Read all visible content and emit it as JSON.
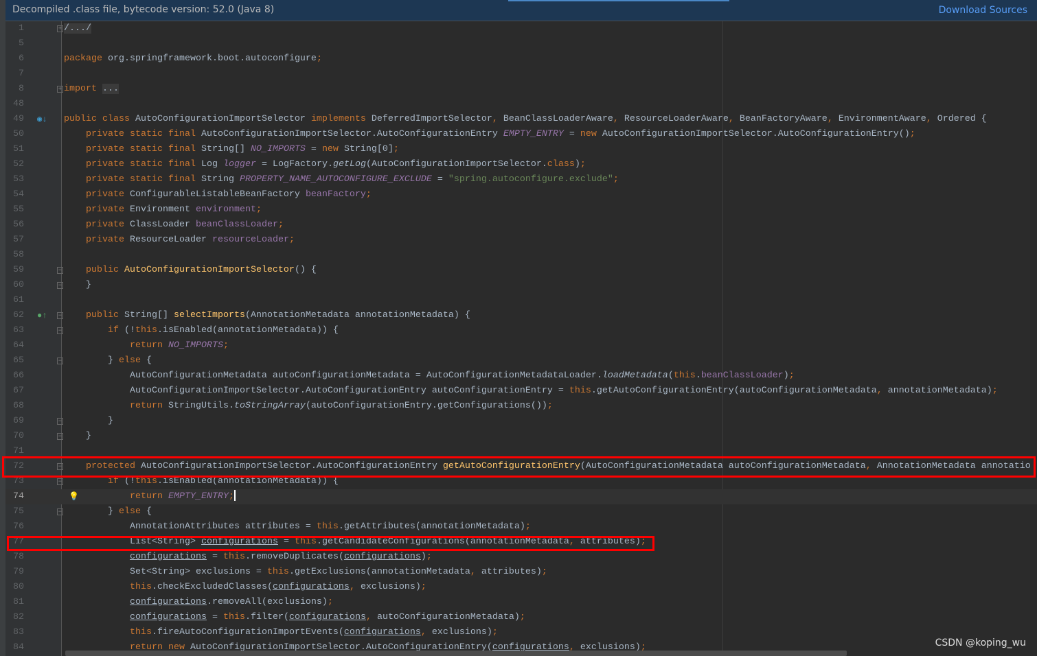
{
  "banner": {
    "message": "Decompiled .class file, bytecode version: 52.0 (Java 8)",
    "download_label": "Download Sources"
  },
  "watermark": "CSDN @koping_wu",
  "colors": {
    "keyword": "#cc7832",
    "text": "#a9b7c6",
    "field": "#9876aa",
    "string": "#6a8759",
    "method": "#ffc66d",
    "highlight_box": "#ff0000"
  },
  "current_line": "74",
  "code": {
    "lines": [
      {
        "n": "1",
        "fold": "plus",
        "tokens": [
          [
            "fd",
            "/.../"
          ]
        ]
      },
      {
        "n": "5",
        "tokens": []
      },
      {
        "n": "6",
        "tokens": [
          [
            "k",
            "package "
          ],
          [
            "t",
            "org.springframework.boot.autoconfigure"
          ],
          [
            "k",
            ";"
          ]
        ]
      },
      {
        "n": "7",
        "tokens": []
      },
      {
        "n": "8",
        "fold": "plus",
        "tokens": [
          [
            "k",
            "import "
          ],
          [
            "fd",
            "..."
          ]
        ]
      },
      {
        "n": "48",
        "tokens": []
      },
      {
        "n": "49",
        "icon": "implemented-icon",
        "tokens": [
          [
            "k",
            "public class "
          ],
          [
            "t",
            "AutoConfigurationImportSelector "
          ],
          [
            "k",
            "implements "
          ],
          [
            "t",
            "DeferredImportSelector"
          ],
          [
            "k",
            ", "
          ],
          [
            "t",
            "BeanClassLoaderAware"
          ],
          [
            "k",
            ", "
          ],
          [
            "t",
            "ResourceLoaderAware"
          ],
          [
            "k",
            ", "
          ],
          [
            "t",
            "BeanFactoryAware"
          ],
          [
            "k",
            ", "
          ],
          [
            "t",
            "EnvironmentAware"
          ],
          [
            "k",
            ", "
          ],
          [
            "t",
            "Ordered {"
          ]
        ]
      },
      {
        "n": "50",
        "tokens": [
          [
            "k",
            "    private static final "
          ],
          [
            "t",
            "AutoConfigurationImportSelector.AutoConfigurationEntry "
          ],
          [
            "sf",
            "EMPTY_ENTRY"
          ],
          [
            "t",
            " = "
          ],
          [
            "k",
            "new "
          ],
          [
            "t",
            "AutoConfigurationImportSelector.AutoConfigurationEntry()"
          ],
          [
            "k",
            ";"
          ]
        ]
      },
      {
        "n": "51",
        "tokens": [
          [
            "k",
            "    private static final "
          ],
          [
            "t",
            "String[] "
          ],
          [
            "sf",
            "NO_IMPORTS"
          ],
          [
            "t",
            " = "
          ],
          [
            "k",
            "new "
          ],
          [
            "t",
            "String[0]"
          ],
          [
            "k",
            ";"
          ]
        ]
      },
      {
        "n": "52",
        "tokens": [
          [
            "k",
            "    private static final "
          ],
          [
            "t",
            "Log "
          ],
          [
            "sf",
            "logger"
          ],
          [
            "t",
            " = LogFactory."
          ],
          [
            "i",
            "getLog"
          ],
          [
            "t",
            "(AutoConfigurationImportSelector."
          ],
          [
            "k",
            "class"
          ],
          [
            "t",
            ")"
          ],
          [
            "k",
            ";"
          ]
        ]
      },
      {
        "n": "53",
        "tokens": [
          [
            "k",
            "    private static final "
          ],
          [
            "t",
            "String "
          ],
          [
            "sf",
            "PROPERTY_NAME_AUTOCONFIGURE_EXCLUDE"
          ],
          [
            "t",
            " = "
          ],
          [
            "s",
            "\"spring.autoconfigure.exclude\""
          ],
          [
            "k",
            ";"
          ]
        ]
      },
      {
        "n": "54",
        "tokens": [
          [
            "k",
            "    private "
          ],
          [
            "t",
            "ConfigurableListableBeanFactory "
          ],
          [
            "f",
            "beanFactory"
          ],
          [
            "k",
            ";"
          ]
        ]
      },
      {
        "n": "55",
        "tokens": [
          [
            "k",
            "    private "
          ],
          [
            "t",
            "Environment "
          ],
          [
            "f",
            "environment"
          ],
          [
            "k",
            ";"
          ]
        ]
      },
      {
        "n": "56",
        "tokens": [
          [
            "k",
            "    private "
          ],
          [
            "t",
            "ClassLoader "
          ],
          [
            "f",
            "beanClassLoader"
          ],
          [
            "k",
            ";"
          ]
        ]
      },
      {
        "n": "57",
        "tokens": [
          [
            "k",
            "    private "
          ],
          [
            "t",
            "ResourceLoader "
          ],
          [
            "f",
            "resourceLoader"
          ],
          [
            "k",
            ";"
          ]
        ]
      },
      {
        "n": "58",
        "tokens": []
      },
      {
        "n": "59",
        "fold": "minus",
        "tokens": [
          [
            "k",
            "    public "
          ],
          [
            "m",
            "AutoConfigurationImportSelector"
          ],
          [
            "t",
            "() {"
          ]
        ]
      },
      {
        "n": "60",
        "fold": "minus",
        "tokens": [
          [
            "t",
            "    }"
          ]
        ]
      },
      {
        "n": "61",
        "tokens": []
      },
      {
        "n": "62",
        "icon": "override-icon",
        "fold": "minus",
        "tokens": [
          [
            "k",
            "    public "
          ],
          [
            "t",
            "String[] "
          ],
          [
            "m",
            "selectImports"
          ],
          [
            "t",
            "(AnnotationMetadata annotationMetadata) {"
          ]
        ]
      },
      {
        "n": "63",
        "fold": "minus",
        "tokens": [
          [
            "k",
            "        if "
          ],
          [
            "t",
            "(!"
          ],
          [
            "k",
            "this"
          ],
          [
            "t",
            ".isEnabled(annotationMetadata)) {"
          ]
        ]
      },
      {
        "n": "64",
        "tokens": [
          [
            "k",
            "            return "
          ],
          [
            "sf",
            "NO_IMPORTS"
          ],
          [
            "k",
            ";"
          ]
        ]
      },
      {
        "n": "65",
        "fold": "minus",
        "tokens": [
          [
            "t",
            "        } "
          ],
          [
            "k",
            "else "
          ],
          [
            "t",
            "{"
          ]
        ]
      },
      {
        "n": "66",
        "tokens": [
          [
            "t",
            "            AutoConfigurationMetadata autoConfigurationMetadata = AutoConfigurationMetadataLoader."
          ],
          [
            "i",
            "loadMetadata"
          ],
          [
            "t",
            "("
          ],
          [
            "k",
            "this"
          ],
          [
            "t",
            "."
          ],
          [
            "f",
            "beanClassLoader"
          ],
          [
            "t",
            ")"
          ],
          [
            "k",
            ";"
          ]
        ]
      },
      {
        "n": "67",
        "tokens": [
          [
            "t",
            "            AutoConfigurationImportSelector.AutoConfigurationEntry autoConfigurationEntry = "
          ],
          [
            "k",
            "this"
          ],
          [
            "t",
            ".getAutoConfigurationEntry(autoConfigurationMetadata"
          ],
          [
            "k",
            ", "
          ],
          [
            "t",
            "annotationMetadata)"
          ],
          [
            "k",
            ";"
          ]
        ]
      },
      {
        "n": "68",
        "tokens": [
          [
            "k",
            "            return "
          ],
          [
            "t",
            "StringUtils."
          ],
          [
            "i",
            "toStringArray"
          ],
          [
            "t",
            "(autoConfigurationEntry.getConfigurations())"
          ],
          [
            "k",
            ";"
          ]
        ]
      },
      {
        "n": "69",
        "fold": "minus",
        "tokens": [
          [
            "t",
            "        }"
          ]
        ]
      },
      {
        "n": "70",
        "fold": "minus",
        "tokens": [
          [
            "t",
            "    }"
          ]
        ]
      },
      {
        "n": "71",
        "tokens": []
      },
      {
        "n": "72",
        "fold": "minus",
        "tokens": [
          [
            "k",
            "    protected "
          ],
          [
            "t",
            "AutoConfigurationImportSelector.AutoConfigurationEntry "
          ],
          [
            "m",
            "getAutoConfigurationEntry"
          ],
          [
            "t",
            "(AutoConfigurationMetadata autoConfigurationMetadata"
          ],
          [
            "k",
            ", "
          ],
          [
            "t",
            "AnnotationMetadata annotatio"
          ]
        ]
      },
      {
        "n": "73",
        "fold": "minus",
        "tokens": [
          [
            "k",
            "        if "
          ],
          [
            "t",
            "(!"
          ],
          [
            "k",
            "this"
          ],
          [
            "t",
            ".isEnabled(annotationMetadata)) {"
          ]
        ]
      },
      {
        "n": "74",
        "icon": "bulb-icon",
        "tokens": [
          [
            "k",
            "            return "
          ],
          [
            "sf",
            "EMPTY_ENTRY"
          ],
          [
            "k",
            ";"
          ]
        ]
      },
      {
        "n": "75",
        "fold": "minus",
        "tokens": [
          [
            "t",
            "        } "
          ],
          [
            "k",
            "else "
          ],
          [
            "t",
            "{"
          ]
        ]
      },
      {
        "n": "76",
        "tokens": [
          [
            "t",
            "            AnnotationAttributes attributes = "
          ],
          [
            "k",
            "this"
          ],
          [
            "t",
            ".getAttributes(annotationMetadata)"
          ],
          [
            "k",
            ";"
          ]
        ]
      },
      {
        "n": "77",
        "tokens": [
          [
            "t",
            "            List<String> "
          ],
          [
            "u",
            "configurations"
          ],
          [
            "t",
            " = "
          ],
          [
            "k",
            "this"
          ],
          [
            "t",
            ".getCandidateConfigurations(annotationMetadata"
          ],
          [
            "k",
            ", "
          ],
          [
            "t",
            "attributes)"
          ],
          [
            "k",
            ";"
          ]
        ]
      },
      {
        "n": "78",
        "tokens": [
          [
            "t",
            "            "
          ],
          [
            "u",
            "configurations"
          ],
          [
            "t",
            " = "
          ],
          [
            "k",
            "this"
          ],
          [
            "t",
            ".removeDuplicates("
          ],
          [
            "u",
            "configurations"
          ],
          [
            "t",
            ")"
          ],
          [
            "k",
            ";"
          ]
        ]
      },
      {
        "n": "79",
        "tokens": [
          [
            "t",
            "            Set<String> exclusions = "
          ],
          [
            "k",
            "this"
          ],
          [
            "t",
            ".getExclusions(annotationMetadata"
          ],
          [
            "k",
            ", "
          ],
          [
            "t",
            "attributes)"
          ],
          [
            "k",
            ";"
          ]
        ]
      },
      {
        "n": "80",
        "tokens": [
          [
            "k",
            "            this"
          ],
          [
            "t",
            ".checkExcludedClasses("
          ],
          [
            "u",
            "configurations"
          ],
          [
            "k",
            ", "
          ],
          [
            "t",
            "exclusions)"
          ],
          [
            "k",
            ";"
          ]
        ]
      },
      {
        "n": "81",
        "tokens": [
          [
            "t",
            "            "
          ],
          [
            "u",
            "configurations"
          ],
          [
            "t",
            ".removeAll(exclusions)"
          ],
          [
            "k",
            ";"
          ]
        ]
      },
      {
        "n": "82",
        "tokens": [
          [
            "t",
            "            "
          ],
          [
            "u",
            "configurations"
          ],
          [
            "t",
            " = "
          ],
          [
            "k",
            "this"
          ],
          [
            "t",
            ".filter("
          ],
          [
            "u",
            "configurations"
          ],
          [
            "k",
            ", "
          ],
          [
            "t",
            "autoConfigurationMetadata)"
          ],
          [
            "k",
            ";"
          ]
        ]
      },
      {
        "n": "83",
        "tokens": [
          [
            "k",
            "            this"
          ],
          [
            "t",
            ".fireAutoConfigurationImportEvents("
          ],
          [
            "u",
            "configurations"
          ],
          [
            "k",
            ", "
          ],
          [
            "t",
            "exclusions)"
          ],
          [
            "k",
            ";"
          ]
        ]
      },
      {
        "n": "84",
        "tokens": [
          [
            "k",
            "            return new "
          ],
          [
            "t",
            "AutoConfigurationImportSelector.AutoConfigurationEntry("
          ],
          [
            "u",
            "configurations"
          ],
          [
            "k",
            ", "
          ],
          [
            "t",
            "exclusions)"
          ],
          [
            "k",
            ";"
          ]
        ]
      }
    ]
  }
}
